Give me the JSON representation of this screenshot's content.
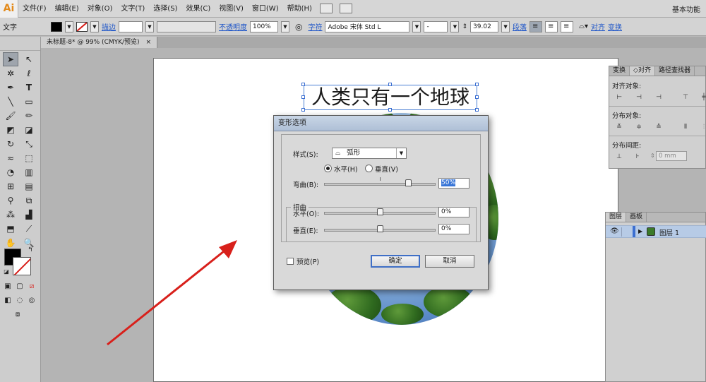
{
  "app": {
    "logo": "Ai",
    "workspace": "基本功能"
  },
  "menu": [
    "文件(F)",
    "编辑(E)",
    "对象(O)",
    "文字(T)",
    "选择(S)",
    "效果(C)",
    "视图(V)",
    "窗口(W)",
    "帮助(H)"
  ],
  "control": {
    "tool_name": "文字",
    "stroke_label": "描边",
    "opacity_label": "不透明度",
    "opacity_value": "100%",
    "character_label": "字符",
    "font_family": "Adobe 宋体 Std L",
    "font_style": "-",
    "font_size": "39.02",
    "paragraph_label": "段落",
    "align_label": "对齐",
    "transform_label": "变换"
  },
  "document": {
    "tab_title": "未标题-8* @ 99% (CMYK/预览)",
    "close_glyph": "×"
  },
  "canvas": {
    "headline": "人类只有一个地球"
  },
  "dialog": {
    "title": "变形选项",
    "style_label": "样式(S):",
    "style_icon": "arc-icon",
    "style_value": "弧形",
    "horizontal_radio": "水平(H)",
    "vertical_radio": "垂直(V)",
    "bend_label": "弯曲(B):",
    "bend_value": "50%",
    "bend_fraction": 0.75,
    "distortion_title": "扭曲",
    "dist_horizontal_label": "水平(O):",
    "dist_horizontal_value": "0%",
    "dist_vertical_label": "垂直(E):",
    "dist_vertical_value": "0%",
    "preview_label": "预览(P)",
    "ok_label": "确定",
    "cancel_label": "取消"
  },
  "align_panel": {
    "tabs": [
      "变换",
      "对齐",
      "路径查找器"
    ],
    "align_objects_label": "对齐对象:",
    "distribute_objects_label": "分布对象:",
    "distribute_spacing_label": "分布间距:",
    "spacing_value": "0 mm"
  },
  "layers_panel": {
    "tabs": [
      "图层",
      "画板"
    ],
    "layer_name": "图层 1"
  },
  "colors": {
    "selection": "#3c6fd1",
    "arrow": "#d8201b",
    "accent_link": "#1f56c8"
  }
}
